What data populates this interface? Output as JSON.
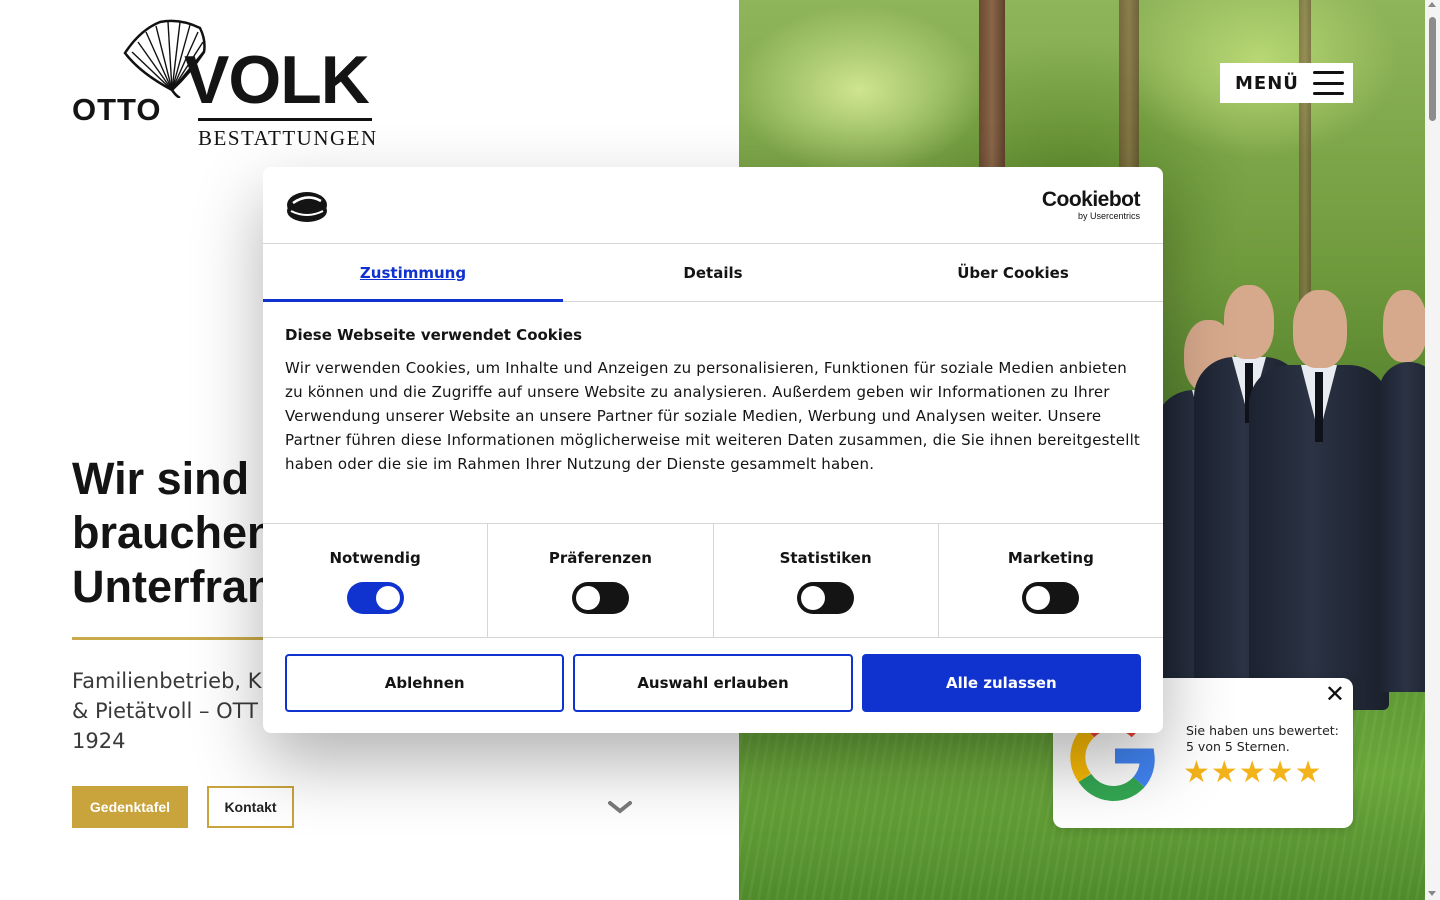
{
  "header": {
    "logo": {
      "first": "OTTO",
      "name": "VOLK",
      "tagline": "BESTATTUNGEN"
    },
    "menu_label": "MENÜ"
  },
  "hero": {
    "headline_lines": [
      "Wir sind d",
      "brauchen",
      "Unterfran"
    ],
    "subline_lines": [
      "Familienbetrieb, K",
      "& Pietätvoll – OTT",
      "1924"
    ],
    "buttons": {
      "primary": "Gedenktafel",
      "secondary": "Kontakt"
    }
  },
  "cookie_dialog": {
    "brand": {
      "name": "Cookiebot",
      "by": "by Usercentrics"
    },
    "tabs": [
      {
        "label": "Zustimmung",
        "active": true
      },
      {
        "label": "Details",
        "active": false
      },
      {
        "label": "Über Cookies",
        "active": false
      }
    ],
    "title": "Diese Webseite verwendet Cookies",
    "body": "Wir verwenden Cookies, um Inhalte und Anzeigen zu personalisieren, Funktionen für soziale Medien anbieten zu können und die Zugriffe auf unsere Website zu analysieren. Außerdem geben wir Informationen zu Ihrer Verwendung unserer Website an unsere Partner für soziale Medien, Werbung und Analysen weiter. Unsere Partner führen diese Informationen möglicherweise mit weiteren Daten zusammen, die Sie ihnen bereitgestellt haben oder die sie im Rahmen Ihrer Nutzung der Dienste gesammelt haben.",
    "categories": [
      {
        "label": "Notwendig",
        "enabled": true
      },
      {
        "label": "Präferenzen",
        "enabled": false
      },
      {
        "label": "Statistiken",
        "enabled": false
      },
      {
        "label": "Marketing",
        "enabled": false
      }
    ],
    "buttons": {
      "deny": "Ablehnen",
      "selection": "Auswahl erlauben",
      "allow_all": "Alle zulassen"
    }
  },
  "rating_widget": {
    "line1": "Sie haben uns bewertet:",
    "line2": "5 von 5 Sternen.",
    "stars": "★★★★★",
    "rating_value": 5,
    "close": "✕"
  },
  "colors": {
    "accent_gold": "#c9a43c",
    "cookie_blue": "#1032cf",
    "text": "#141414"
  }
}
